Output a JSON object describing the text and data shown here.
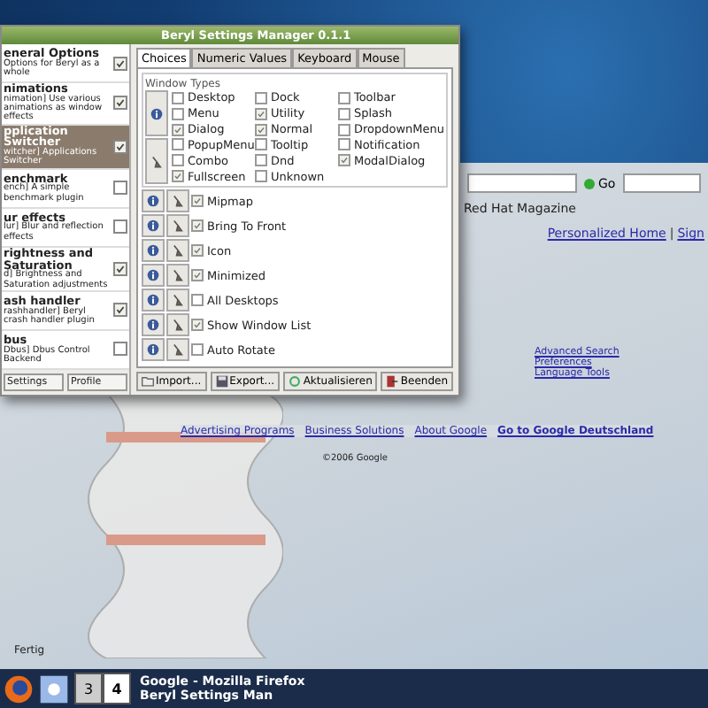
{
  "settings_window": {
    "title": "Beryl Settings Manager 0.1.1",
    "plugins": [
      {
        "name": "eneral Options",
        "description": "Options for Beryl as a whole",
        "enabled": true,
        "selected": false
      },
      {
        "name": "nimations",
        "description": "nimation] Use various animations as window effects",
        "enabled": true,
        "selected": false
      },
      {
        "name": "pplication Switcher",
        "description": "witcher] Applications Switcher",
        "enabled": true,
        "selected": true
      },
      {
        "name": "enchmark",
        "description": "ench] A simple benchmark plugin",
        "enabled": false,
        "selected": false
      },
      {
        "name": "ur effects",
        "description": "lur] Blur and reflection effects",
        "enabled": false,
        "selected": false
      },
      {
        "name": "rightness and Saturation",
        "description": "d] Brightness and Saturation adjustments",
        "enabled": true,
        "selected": false
      },
      {
        "name": "ash handler",
        "description": "rashhandler] Beryl crash handler plugin",
        "enabled": true,
        "selected": false
      },
      {
        "name": "bus",
        "description": "Dbus] Dbus Control Backend",
        "enabled": false,
        "selected": false
      }
    ],
    "combos": [
      "Settings",
      "Profile"
    ],
    "tabs": [
      {
        "label": "Choices",
        "selected": true
      },
      {
        "label": "Numeric Values",
        "selected": false
      },
      {
        "label": "Keyboard",
        "selected": false
      },
      {
        "label": "Mouse",
        "selected": false
      }
    ],
    "group_title": "Window Types",
    "window_types": [
      {
        "label": "Desktop",
        "checked": false
      },
      {
        "label": "Dock",
        "checked": false
      },
      {
        "label": "Toolbar",
        "checked": false
      },
      {
        "label": "Menu",
        "checked": false
      },
      {
        "label": "Utility",
        "checked": true
      },
      {
        "label": "Splash",
        "checked": false
      },
      {
        "label": "Dialog",
        "checked": true
      },
      {
        "label": "Normal",
        "checked": true
      },
      {
        "label": "DropdownMenu",
        "checked": false
      },
      {
        "label": "PopupMenu",
        "checked": false
      },
      {
        "label": "Tooltip",
        "checked": false
      },
      {
        "label": "Notification",
        "checked": false
      },
      {
        "label": "Combo",
        "checked": false
      },
      {
        "label": "Dnd",
        "checked": false
      },
      {
        "label": "ModalDialog",
        "checked": true
      },
      {
        "label": "Fullscreen",
        "checked": true
      },
      {
        "label": "Unknown",
        "checked": false
      }
    ],
    "options": [
      {
        "label": "Mipmap",
        "checked": true
      },
      {
        "label": "Bring To Front",
        "checked": true
      },
      {
        "label": "Icon",
        "checked": true
      },
      {
        "label": "Minimized",
        "checked": true
      },
      {
        "label": "All Desktops",
        "checked": false
      },
      {
        "label": "Show Window List",
        "checked": true
      },
      {
        "label": "Auto Rotate",
        "checked": false
      }
    ],
    "buttons": [
      {
        "label": "Import...",
        "kind": "import"
      },
      {
        "label": "Export...",
        "kind": "export"
      },
      {
        "label": "Aktualisieren",
        "kind": "refresh"
      },
      {
        "label": "Beenden",
        "kind": "quit"
      }
    ]
  },
  "browser": {
    "go_button": "Go",
    "bookmark": "Red Hat Magazine",
    "top_links": [
      "Personalized Home",
      "Sign"
    ],
    "top_separator": "|",
    "side_links": [
      "Advanced Search",
      "Preferences",
      "Language Tools"
    ],
    "footer_links": [
      "Advertising Programs",
      "Business Solutions",
      "About Google",
      "Go to Google Deutschland"
    ],
    "copyright": "©2006 Google",
    "status": "Fertig"
  },
  "taskbar": {
    "workspaces": [
      {
        "label": "3",
        "selected": false
      },
      {
        "label": "4",
        "selected": true
      }
    ],
    "tasks": [
      "Google - Mozilla Firefox",
      "Beryl Settings Man"
    ]
  }
}
